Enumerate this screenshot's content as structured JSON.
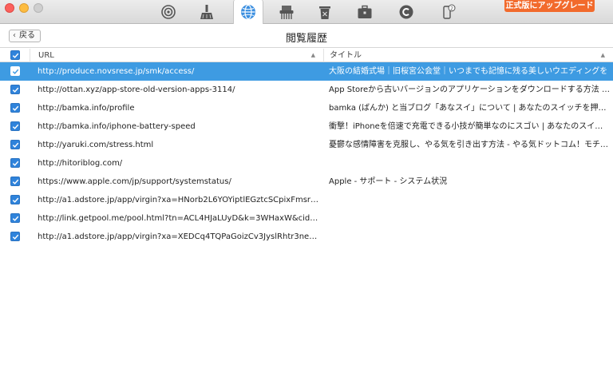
{
  "window": {
    "toolbar_tools": [
      {
        "icon": "target-icon"
      },
      {
        "icon": "broom-icon"
      },
      {
        "icon": "globe-icon",
        "active": true
      },
      {
        "icon": "shredder-icon"
      },
      {
        "icon": "trash-icon"
      },
      {
        "icon": "briefcase-icon"
      },
      {
        "icon": "copyright-icon"
      },
      {
        "icon": "phone-badge-icon",
        "badge": "2"
      }
    ],
    "upgrade_label": "正式版にアップグレード"
  },
  "header": {
    "back_label": "戻る",
    "title": "閲覧履歴"
  },
  "table": {
    "columns": {
      "url": "URL",
      "title": "タイトル"
    },
    "rows": [
      {
        "checked": true,
        "selected": true,
        "url": "http://produce.novsrese.jp/smk/access/",
        "title": "大阪の結婚式場｜旧桜宮公会堂｜いつまでも記憶に残る美しいウエディングを"
      },
      {
        "checked": true,
        "url": "http://ottan.xyz/app-store-old-version-apps-3114/",
        "title": "App Storeから古いバージョンのアプリケーションをダウンロードする方法 – OTTA..."
      },
      {
        "checked": true,
        "url": "http://bamka.info/profile",
        "title": "bamka (ばんか) と当ブログ「あなスイ」について | あなたのスイッチを押すブログ"
      },
      {
        "checked": true,
        "url": "http://bamka.info/iphone-battery-speed",
        "title": "衝撃！iPhoneを倍速で充電できる小技が簡単なのにスゴい | あなたのスイッチを押..."
      },
      {
        "checked": true,
        "url": "http://yaruki.com/stress.html",
        "title": "憂鬱な感情障害を克服し、やる気を引き出す方法 - やる気ドットコム！モチベーシ..."
      },
      {
        "checked": true,
        "url": "http://hitoriblog.com/",
        "title": ""
      },
      {
        "checked": true,
        "url": "https://www.apple.com/jp/support/systemstatus/",
        "title": "Apple - サポート - システム状況"
      },
      {
        "checked": true,
        "url": "http://a1.adstore.jp/app/virgin?xa=HNorb2L6YOYiptlEGztcSCpixFmsr5lnPlbPiTyZE...",
        "title": ""
      },
      {
        "checked": true,
        "url": "http://link.getpool.me/pool.html?tn=ACL4HJaLUyD&k=3WHaxW&cid=27250&af=m...",
        "title": ""
      },
      {
        "checked": true,
        "url": "http://a1.adstore.jp/app/virgin?xa=XEDCq4TQPaGoizCv3JyslRhtr3neHKqzYX69vb3...",
        "title": ""
      }
    ]
  },
  "colors": {
    "selection": "#3e9be2",
    "checkbox": "#2f83db",
    "upgrade": "#f26a2c"
  }
}
